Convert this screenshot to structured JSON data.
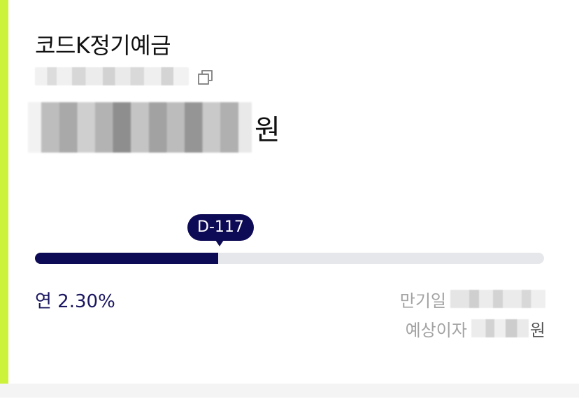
{
  "account": {
    "product_name": "코드K정기예금",
    "currency_unit": "원"
  },
  "progress": {
    "d_day_label": "D-117",
    "fraction": 0.36
  },
  "details": {
    "rate_text": "연 2.30%",
    "maturity_label": "만기일",
    "interest_label": "예상이자",
    "interest_unit": "원"
  },
  "colors": {
    "accent": "#cdf23a",
    "primary": "#0e0b56"
  },
  "icons": {
    "copy": "copy-icon"
  }
}
